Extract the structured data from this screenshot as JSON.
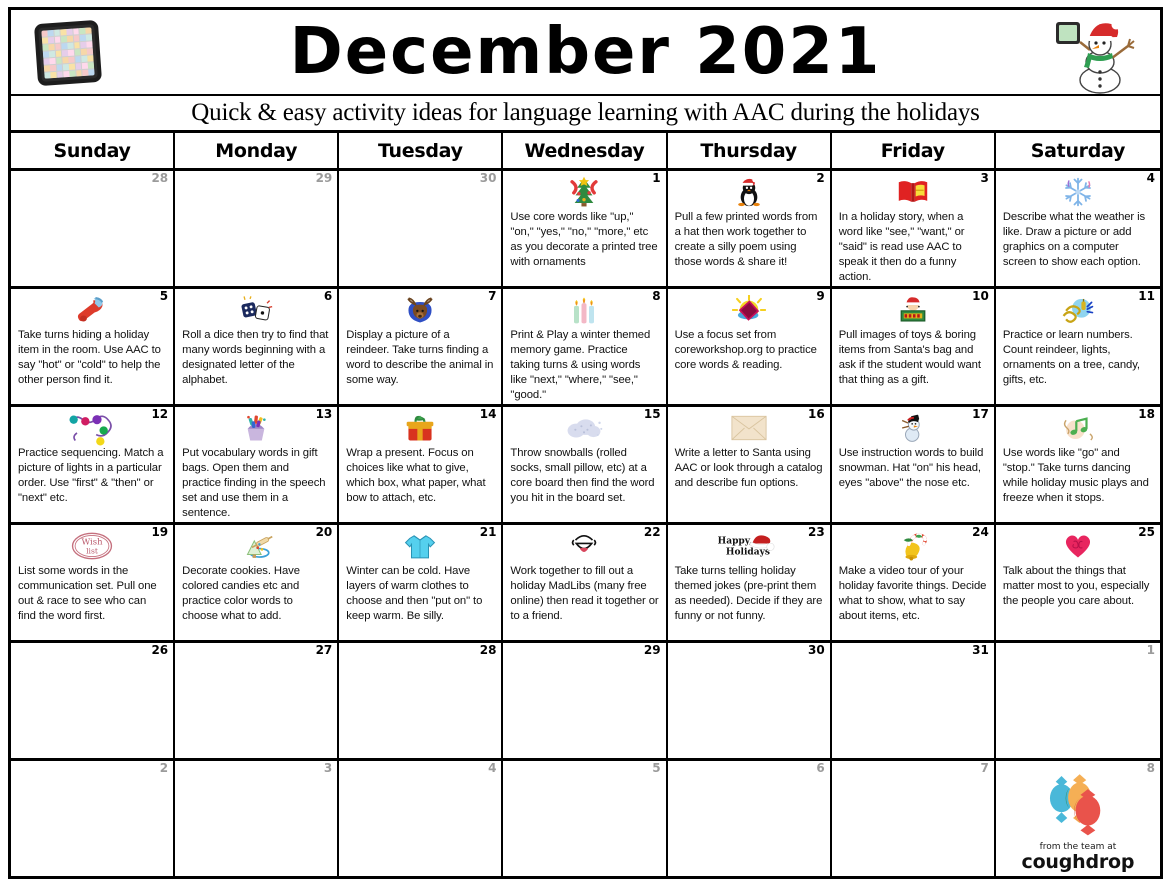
{
  "header": {
    "title": "December 2021",
    "subtitle": "Quick & easy activity ideas for language learning with AAC during the holidays",
    "tablet_icon": "aac-tablet-icon",
    "snowman_icon": "snowman-with-tablet-icon"
  },
  "weekdays": [
    "Sunday",
    "Monday",
    "Tuesday",
    "Wednesday",
    "Thursday",
    "Friday",
    "Saturday"
  ],
  "footer": {
    "from_label": "from the team at",
    "brand": "coughdrop",
    "logo_icon": "coughdrop-candies-logo"
  },
  "colors": {
    "grid_line": "#000000",
    "muted_daynum": "#9b9b9b",
    "daynum": "#000000",
    "text": "#111111",
    "cd_blue": "#3bb3d6",
    "cd_orange": "#f5a947",
    "cd_red": "#e8453c",
    "cd_green": "#2e8f6e"
  },
  "weeks": [
    [
      {
        "num": "28",
        "muted": true,
        "icon": "",
        "text": ""
      },
      {
        "num": "29",
        "muted": true,
        "icon": "",
        "text": ""
      },
      {
        "num": "30",
        "muted": true,
        "icon": "",
        "text": ""
      },
      {
        "num": "1",
        "muted": false,
        "icon": "christmas-tree-icon",
        "text": "Use core words like \"up,\" \"on,\" \"yes,\" \"no,\" \"more,\" etc as you decorate a printed tree with ornaments"
      },
      {
        "num": "2",
        "muted": false,
        "icon": "penguin-santa-hat-icon",
        "text": "Pull a few printed words from a hat then work together to create a silly poem using those words & share it!"
      },
      {
        "num": "3",
        "muted": false,
        "icon": "open-book-icon",
        "text": "In a holiday story, when a word like \"see,\" \"want,\" or \"said\" is read use AAC to speak it then do a funny action."
      },
      {
        "num": "4",
        "muted": false,
        "icon": "snowflake-icon",
        "text": "Describe what the weather is like.  Draw a picture or add graphics on a computer screen to show each option."
      }
    ],
    [
      {
        "num": "5",
        "muted": false,
        "icon": "stocking-icon",
        "text": "Take turns hiding a holiday item in the room.  Use AAC to say \"hot\" or \"cold\" to help the other person find it."
      },
      {
        "num": "6",
        "muted": false,
        "icon": "dice-icon",
        "text": "Roll a dice then try to find that many words beginning with a designated letter of the alphabet."
      },
      {
        "num": "7",
        "muted": false,
        "icon": "reindeer-icon",
        "text": "Display a picture of a reindeer.  Take turns finding a word to describe the animal in some way."
      },
      {
        "num": "8",
        "muted": false,
        "icon": "candles-icon",
        "text": "Print & Play a winter themed memory game. Practice taking turns & using words like \"next,\" \"where,\" \"see,\" \"good.\""
      },
      {
        "num": "9",
        "muted": false,
        "icon": "shining-book-icon",
        "text": "Use a focus set from coreworkshop.org to practice core words & reading."
      },
      {
        "num": "10",
        "muted": false,
        "icon": "santa-sign-icon",
        "text": "Pull images of toys & boring items from Santa's bag and ask if the student would want that thing as a gift."
      },
      {
        "num": "11",
        "muted": false,
        "icon": "string-lights-icon",
        "text": "Practice or learn numbers.  Count reindeer, lights, ornaments on a tree, candy, gifts, etc."
      }
    ],
    [
      {
        "num": "12",
        "muted": false,
        "icon": "holiday-lights-icon",
        "text": "Practice sequencing. Match a picture of lights in a particular order. Use \"first\" & \"then\" or \"next\" etc."
      },
      {
        "num": "13",
        "muted": false,
        "icon": "gift-bag-icon",
        "text": "Put vocabulary words in gift bags.  Open them and practice finding in the speech set and use them in a sentence."
      },
      {
        "num": "14",
        "muted": false,
        "icon": "wrapped-present-icon",
        "text": "Wrap a present.  Focus on choices like what to give, which box, what paper, what bow to attach, etc."
      },
      {
        "num": "15",
        "muted": false,
        "icon": "snow-cloud-icon",
        "text": "Throw snowballs (rolled socks, small pillow, etc) at a core board then find the word you hit in the board set."
      },
      {
        "num": "16",
        "muted": false,
        "icon": "envelope-icon",
        "text": "Write a letter to Santa using AAC or look through a catalog and describe fun options."
      },
      {
        "num": "17",
        "muted": false,
        "icon": "snowman-icon",
        "text": "Use instruction words to build snowman.  Hat \"on\" his head, eyes \"above\" the nose etc."
      },
      {
        "num": "18",
        "muted": false,
        "icon": "music-notes-icon",
        "text": "Use words like \"go\" and \"stop.\" Take turns dancing while holiday music plays and freeze when it stops."
      }
    ],
    [
      {
        "num": "19",
        "muted": false,
        "icon": "wish-list-stamp-icon",
        "text": "List some words in the communication set. Pull one out & race to see who can find the word first."
      },
      {
        "num": "20",
        "muted": false,
        "icon": "cookie-decorating-icon",
        "text": "Decorate cookies.  Have colored candies etc and practice color words to choose what to add."
      },
      {
        "num": "21",
        "muted": false,
        "icon": "shirt-icon",
        "text": "Winter can be cold. Have layers of warm clothes to choose and then \"put on\" to keep warm. Be silly."
      },
      {
        "num": "22",
        "muted": false,
        "icon": "laughing-mouth-icon",
        "text": "Work together to fill out a holiday MadLibs (many free online) then read it together or to a friend."
      },
      {
        "num": "23",
        "muted": false,
        "icon": "happy-holidays-icon",
        "text": "Take turns telling holiday themed jokes (pre-print them as needed).  Decide if they are funny or not funny."
      },
      {
        "num": "24",
        "muted": false,
        "icon": "bell-candycane-icon",
        "text": "Make a video tour of your holiday favorite things.  Decide what to show, what to say about items, etc."
      },
      {
        "num": "25",
        "muted": false,
        "icon": "heart-icon",
        "text": "Talk about the things that matter most to you, especially the people you care about."
      }
    ],
    [
      {
        "num": "26",
        "muted": false,
        "icon": "",
        "text": ""
      },
      {
        "num": "27",
        "muted": false,
        "icon": "",
        "text": ""
      },
      {
        "num": "28",
        "muted": false,
        "icon": "",
        "text": ""
      },
      {
        "num": "29",
        "muted": false,
        "icon": "",
        "text": ""
      },
      {
        "num": "30",
        "muted": false,
        "icon": "",
        "text": ""
      },
      {
        "num": "31",
        "muted": false,
        "icon": "",
        "text": ""
      },
      {
        "num": "1",
        "muted": true,
        "icon": "",
        "text": ""
      }
    ],
    [
      {
        "num": "2",
        "muted": true,
        "icon": "",
        "text": ""
      },
      {
        "num": "3",
        "muted": true,
        "icon": "",
        "text": ""
      },
      {
        "num": "4",
        "muted": true,
        "icon": "",
        "text": ""
      },
      {
        "num": "5",
        "muted": true,
        "icon": "",
        "text": ""
      },
      {
        "num": "6",
        "muted": true,
        "icon": "",
        "text": ""
      },
      {
        "num": "7",
        "muted": true,
        "icon": "",
        "text": ""
      },
      {
        "num": "8",
        "muted": true,
        "icon": "",
        "text": ""
      }
    ]
  ]
}
